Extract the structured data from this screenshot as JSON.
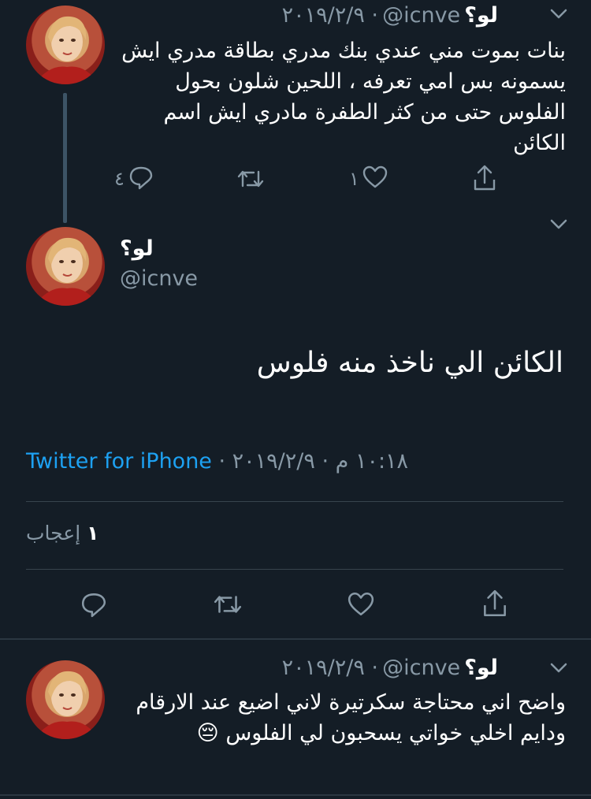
{
  "tweet1": {
    "name": "لو؟",
    "handle": "@icnve",
    "date": "· ٢٠١٩/٢/٩",
    "text": "بنات بموت مني عندي بنك مدري بطاقة مدري ايش يسمونه بس امي تعرفه ، اللحين شلون بحول الفلوس حتى من كثر الطفرة مادري ايش اسم الكائن",
    "reply_count": "٤",
    "like_count": "١"
  },
  "main_tweet": {
    "name": "لو؟",
    "handle": "@icnve",
    "text": "الكائن الي ناخذ منه فلوس",
    "time_date": "١٠:١٨ م · ٢٠١٩/٢/٩",
    "separator": " · ",
    "source": "Twitter for iPhone",
    "likes_number": "١",
    "likes_label": "إعجاب"
  },
  "tweet3": {
    "name": "لو؟",
    "handle": "@icnve",
    "date": "· ٢٠١٩/٢/٩",
    "text": "واضح اني محتاجة سكرتيرة لاني اضيع عند الارقام ودايم اخلي خواتي يسحبون لي الفلوس 😔"
  },
  "icons": [
    "chevron-down-icon",
    "reply-icon",
    "retweet-icon",
    "like-icon",
    "share-icon"
  ],
  "colors": {
    "background": "#141d26",
    "muted": "#8899a6",
    "link": "#1da1f2",
    "divider": "#38444d"
  }
}
